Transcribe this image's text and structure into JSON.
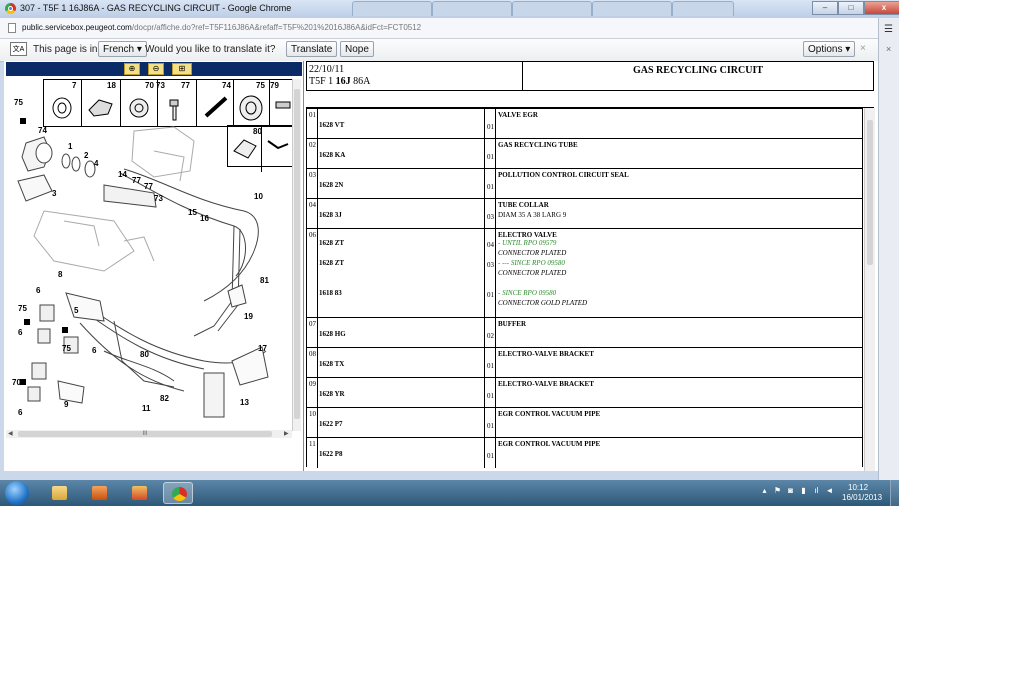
{
  "window": {
    "title": "307 - T5F 1 16J86A - GAS RECYCLING CIRCUIT - Google Chrome",
    "controls": {
      "minimize": "–",
      "maximize": "□",
      "close": "x"
    }
  },
  "address_bar": {
    "host": "public.servicebox.peugeot.com",
    "path": "/docpr/affiche.do?ref=T5F116J86A&refaff=T5F%201%2016J86A&idFct=FCT0512"
  },
  "translate_bar": {
    "icon": "translate-icon",
    "prefix": "This page is in",
    "language": "French",
    "question": "Would you like to translate it?",
    "translate_label": "Translate",
    "nope_label": "Nope",
    "options_label": "Options",
    "close_label": "×"
  },
  "diagram": {
    "strip_labels": [
      "7",
      "18",
      "70",
      "73",
      "77",
      "74",
      "75",
      "79",
      "80"
    ],
    "callouts": [
      "75",
      "74",
      "1",
      "2",
      "3",
      "4",
      "14",
      "77",
      "77",
      "73",
      "15",
      "16",
      "10",
      "8",
      "6",
      "5",
      "75",
      "6",
      "75",
      "6",
      "80",
      "81",
      "19",
      "17",
      "70",
      "6",
      "9",
      "11",
      "82",
      "13"
    ],
    "scroll_thumb_label": "III"
  },
  "sheet": {
    "date": "22/10/11",
    "ref_prefix": "T5F 1 ",
    "ref_bold": "16J",
    "ref_suffix": " 86A",
    "title": "GAS RECYCLING CIRCUIT"
  },
  "parts": [
    {
      "num": "01",
      "lines": [
        {
          "code": "1628 VT",
          "qty": "01"
        }
      ],
      "desc": "VALVE EGR",
      "details": []
    },
    {
      "num": "02",
      "lines": [
        {
          "code": "1628 KA",
          "qty": "01"
        }
      ],
      "desc": "GAS RECYCLING TUBE",
      "details": []
    },
    {
      "num": "03",
      "lines": [
        {
          "code": "1628 2N",
          "qty": "01"
        }
      ],
      "desc": "POLLUTION CONTROL CIRCUIT SEAL",
      "details": []
    },
    {
      "num": "04",
      "lines": [
        {
          "code": "1628 3J",
          "qty": "03"
        }
      ],
      "desc": "TUBE COLLAR",
      "details": [
        {
          "text": "DIAM 35 A 38 LARG 9",
          "style": "plain"
        }
      ]
    },
    {
      "num": "06",
      "lines": [
        {
          "code": "1628 ZT",
          "qty": "04"
        },
        {
          "code": "1628 ZT",
          "qty": "03"
        },
        {
          "code": "1618 83",
          "qty": "01"
        }
      ],
      "desc": "ELECTRO VALVE",
      "details": [
        {
          "text": "- UNTIL RPO 09579",
          "style": "green"
        },
        {
          "text": "CONNECTOR PLATED",
          "style": "italic"
        },
        {
          "text": "- --- SINCE RPO 09580",
          "style": "green"
        },
        {
          "text": "CONNECTOR PLATED",
          "style": "italic"
        },
        {
          "text": "- SINCE RPO 09580",
          "style": "green"
        },
        {
          "text": "CONNECTOR GOLD PLATED",
          "style": "italic"
        }
      ]
    },
    {
      "num": "07",
      "lines": [
        {
          "code": "1628 HG",
          "qty": "02"
        }
      ],
      "desc": "BUFFER",
      "details": []
    },
    {
      "num": "08",
      "lines": [
        {
          "code": "1628 TX",
          "qty": "01"
        }
      ],
      "desc": "ELECTRO-VALVE BRACKET",
      "details": []
    },
    {
      "num": "09",
      "lines": [
        {
          "code": "1628 YR",
          "qty": "01"
        }
      ],
      "desc": "ELECTRO-VALVE BRACKET",
      "details": []
    },
    {
      "num": "10",
      "lines": [
        {
          "code": "1622 P7",
          "qty": "01"
        }
      ],
      "desc": "EGR CONTROL VACUUM PIPE",
      "details": []
    },
    {
      "num": "11",
      "lines": [
        {
          "code": "1622 P8",
          "qty": "01"
        }
      ],
      "desc": "EGR CONTROL VACUUM PIPE",
      "details": []
    }
  ],
  "taskbar": {
    "apps": [
      "start-orb",
      "explorer-icon",
      "media-player-icon",
      "servicebox-icon",
      "chrome-icon"
    ],
    "clock_time": "10:12",
    "clock_date": "16/01/2013"
  }
}
